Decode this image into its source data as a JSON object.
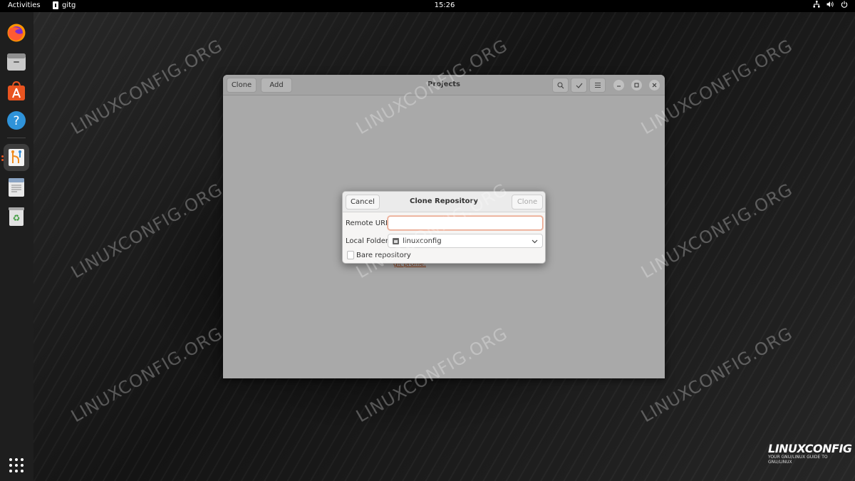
{
  "topbar": {
    "activities": "Activities",
    "app_name": "gitg",
    "clock": "15:26",
    "status_icons": [
      "network-icon",
      "volume-icon",
      "power-icon"
    ]
  },
  "dock": {
    "items": [
      {
        "name": "firefox-icon",
        "running": false
      },
      {
        "name": "files-icon",
        "running": false
      },
      {
        "name": "software-store-icon",
        "running": false
      },
      {
        "name": "help-icon",
        "running": false
      },
      {
        "name": "gitg-icon",
        "running": true
      },
      {
        "name": "text-editor-icon",
        "running": false
      },
      {
        "name": "trash-icon",
        "running": false
      }
    ],
    "show_apps_icon": "app-grid-icon"
  },
  "window": {
    "title": "Projects",
    "clone_label": "Clone",
    "add_label": "Add",
    "background_link": "git profile",
    "background_link_suffix": "."
  },
  "dialog": {
    "title": "Clone Repository",
    "cancel_label": "Cancel",
    "clone_label": "Clone",
    "remote_url_label": "Remote URL:",
    "remote_url_value": "",
    "local_folder_label": "Local Folder:",
    "local_folder_value": "linuxconfig",
    "bare_repository_label": "Bare repository",
    "bare_repository_checked": false
  },
  "watermark": "LINUXCONFIG.ORG",
  "brand": {
    "name": "LINUXCONFIG",
    "tagline": "YOUR GNU/LINUX GUIDE TO GNU/LINUX"
  },
  "colors": {
    "accent": "#e95420",
    "topbar": "#000000",
    "dock": "#1e1e1e"
  }
}
